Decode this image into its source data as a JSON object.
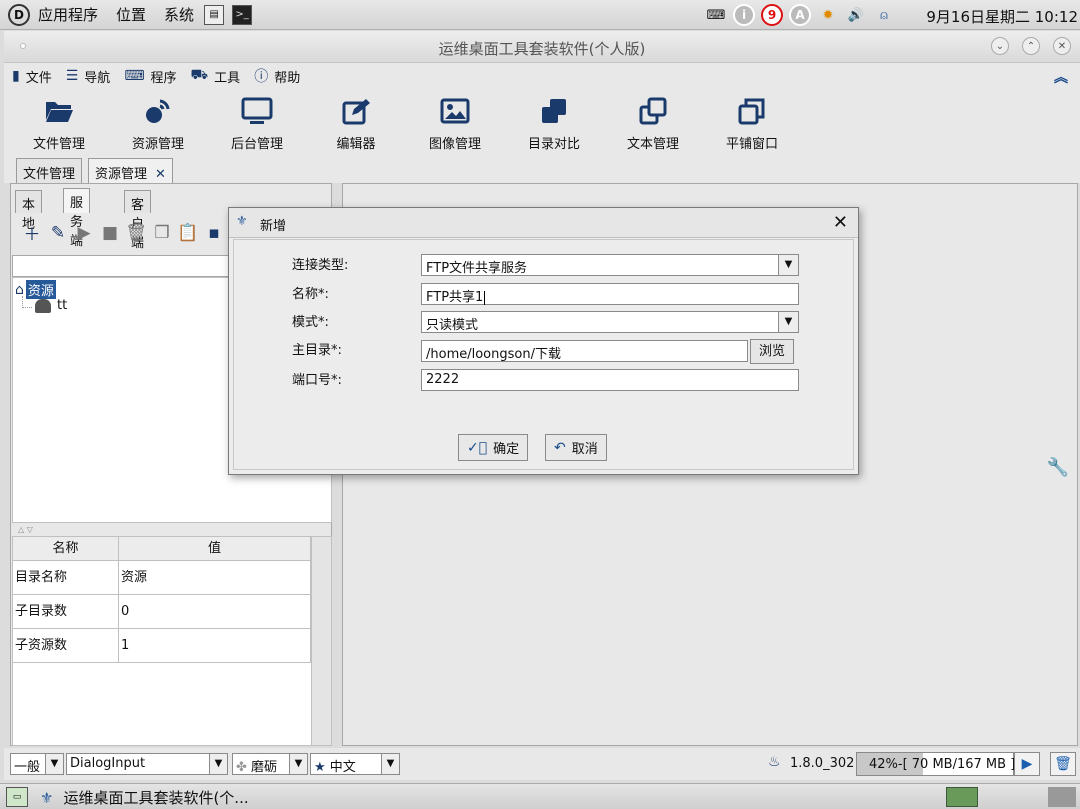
{
  "system_panel": {
    "menus": [
      "应用程序",
      "位置",
      "系统"
    ],
    "tray_badge": "9",
    "clock": "9月16日星期二 10:12"
  },
  "window": {
    "title": "运维桌面工具套装软件(个人版)"
  },
  "menubar": {
    "items": [
      {
        "label": "文件",
        "icon": "file-icon"
      },
      {
        "label": "导航",
        "icon": "list-icon"
      },
      {
        "label": "程序",
        "icon": "keyboard-icon"
      },
      {
        "label": "工具",
        "icon": "toolbox-icon"
      },
      {
        "label": "帮助",
        "icon": "help-icon"
      }
    ]
  },
  "toolbar": {
    "items": [
      {
        "label": "文件管理",
        "icon": "folder-open-icon"
      },
      {
        "label": "资源管理",
        "icon": "satellite-icon"
      },
      {
        "label": "后台管理",
        "icon": "monitor-icon"
      },
      {
        "label": "编辑器",
        "icon": "edit-icon"
      },
      {
        "label": "图像管理",
        "icon": "image-icon"
      },
      {
        "label": "目录对比",
        "icon": "clone-icon"
      },
      {
        "label": "文本管理",
        "icon": "copy-icon"
      },
      {
        "label": "平铺窗口",
        "icon": "windows-icon"
      }
    ]
  },
  "doc_tabs": [
    "文件管理",
    "资源管理"
  ],
  "left_panel": {
    "tabs": [
      "本地",
      "服务端",
      "客户端"
    ],
    "tree": {
      "root": "资源",
      "child": "tt"
    },
    "props": {
      "headers": [
        "名称",
        "值"
      ],
      "rows": [
        {
          "name": "目录名称",
          "value": "资源"
        },
        {
          "name": "子目录数",
          "value": "0"
        },
        {
          "name": "子资源数",
          "value": "1"
        }
      ]
    }
  },
  "dialog": {
    "title": "新增",
    "fields": {
      "type_label": "连接类型:",
      "type_value": "FTP文件共享服务",
      "name_label": "名称*:",
      "name_value": "FTP共享1",
      "mode_label": "模式*:",
      "mode_value": "只读模式",
      "home_label": "主目录*:",
      "home_value": "/home/loongson/下载",
      "port_label": "端口号*:",
      "port_value": "2222"
    },
    "browse_label": "浏览",
    "ok_label": "确定",
    "cancel_label": "取消"
  },
  "statusbar": {
    "general": "一般",
    "font": "DialogInput",
    "theme": "磨砺",
    "language": "中文",
    "java_version": "1.8.0_302",
    "memory_text": "42%-[ 70 MB/167 MB ]",
    "memory_percent": 42
  },
  "taskbar": {
    "task_title": "运维桌面工具套装软件(个..."
  }
}
